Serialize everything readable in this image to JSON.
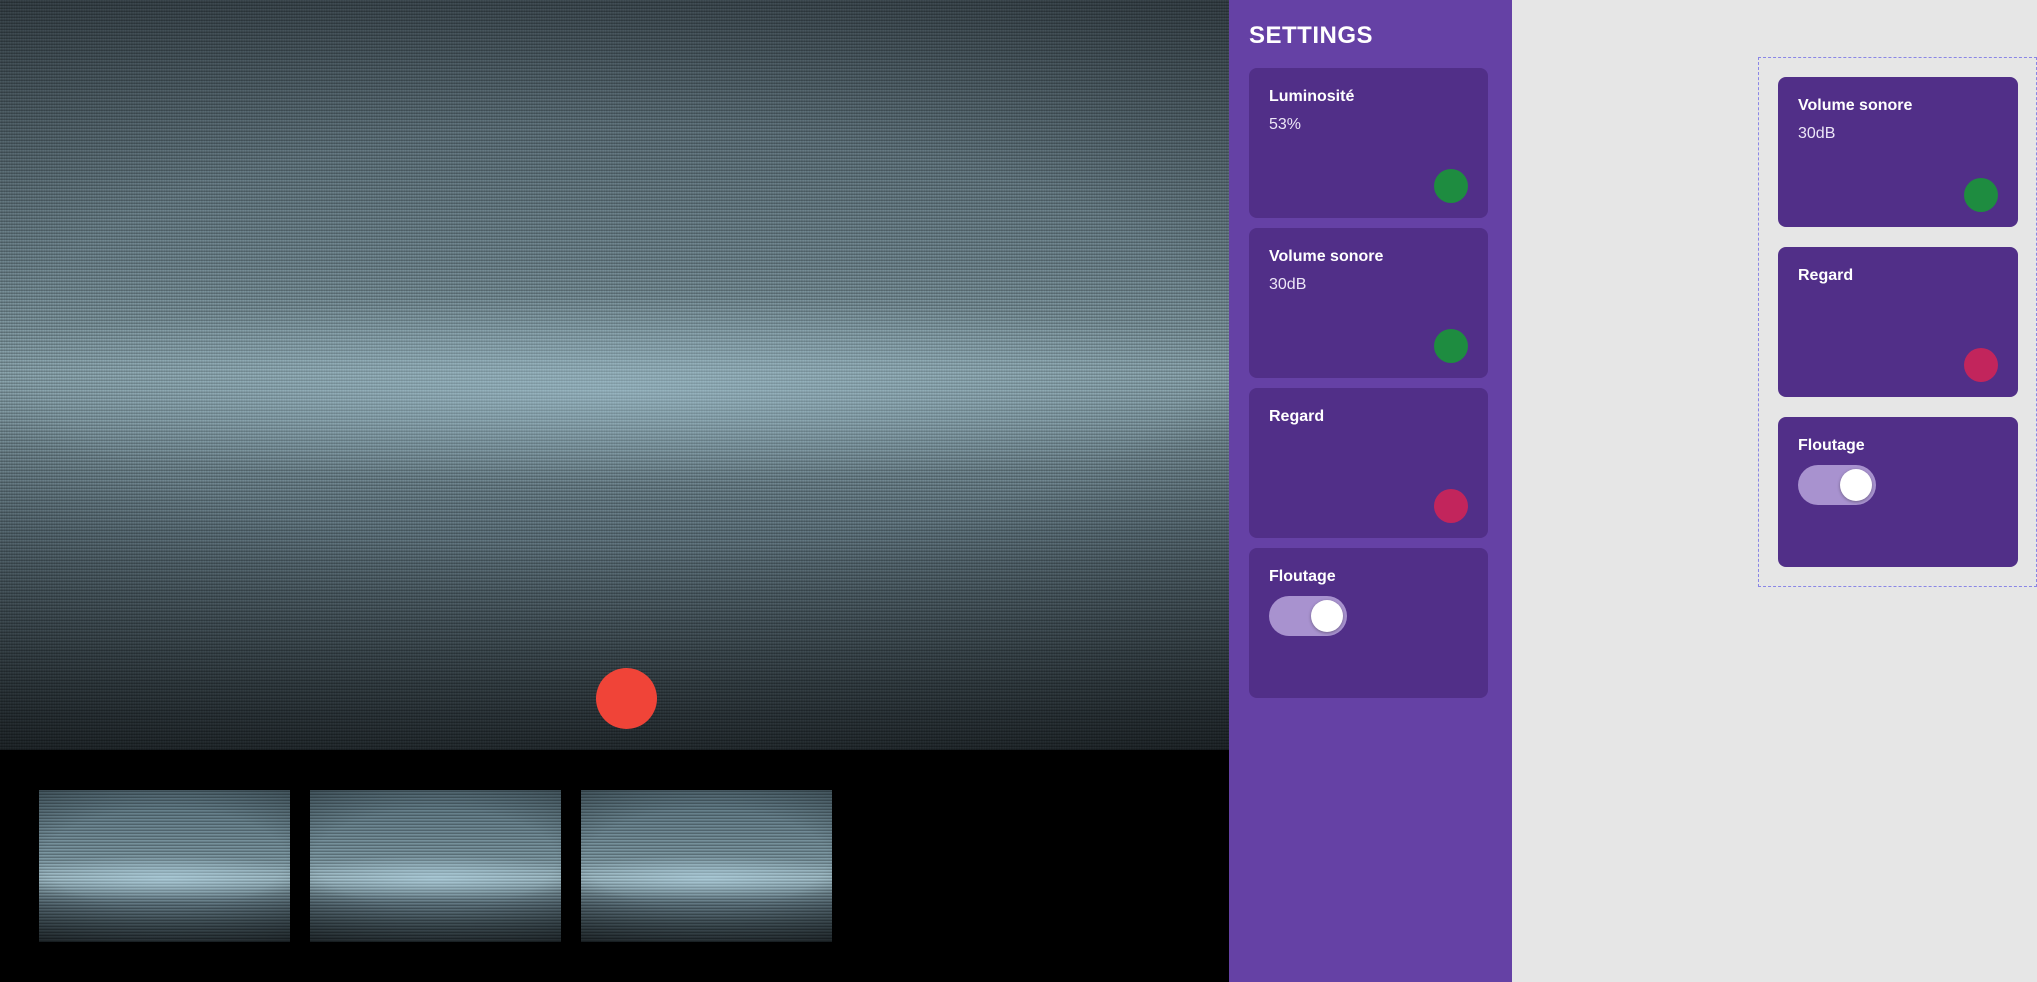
{
  "settings": {
    "title": "SETTINGS",
    "cards": [
      {
        "label": "Luminosité",
        "value": "53%",
        "status": "ok"
      },
      {
        "label": "Volume sonore",
        "value": "30dB",
        "status": "ok"
      },
      {
        "label": "Regard",
        "value": "",
        "status": "alert"
      },
      {
        "label": "Floutage",
        "toggle_on": true
      }
    ]
  },
  "floating": {
    "cards": [
      {
        "label": "Volume sonore",
        "value": "30dB",
        "status": "ok"
      },
      {
        "label": "Regard",
        "value": "",
        "status": "alert"
      },
      {
        "label": "Floutage",
        "toggle_on": true
      }
    ]
  },
  "colors": {
    "sidebar": "#6541a5",
    "card": "#512f88",
    "status_ok": "#1e8c40",
    "status_alert": "#c2255c",
    "record": "#f04438",
    "toggle_track": "#a892cf"
  },
  "icons": {
    "record": "record-dot-icon",
    "status_ok": "status-ok-icon",
    "status_alert": "status-alert-icon"
  }
}
